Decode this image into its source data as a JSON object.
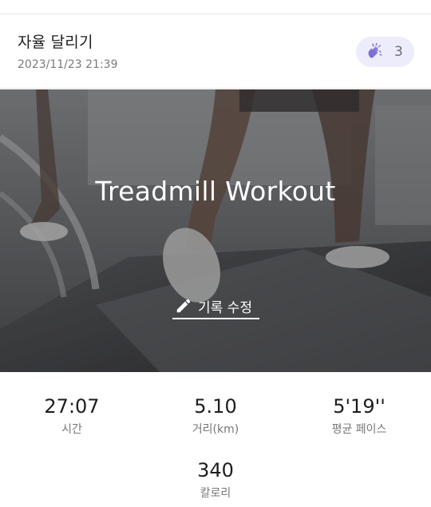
{
  "record": {
    "title": "자율 달리기",
    "datetime": "2023/11/23 21:39",
    "clap_icon": "clapping-hands-icon",
    "clap_count": "3"
  },
  "hero": {
    "title": "Treadmill Workout",
    "edit_icon": "pencil-icon",
    "edit_label": "기록 수정"
  },
  "stats": [
    {
      "value": "27:07",
      "label": "시간"
    },
    {
      "value": "5.10",
      "label": "거리(km)"
    },
    {
      "value": "5'19''",
      "label": "평균 페이스"
    },
    {
      "value": "340",
      "label": "칼로리"
    }
  ],
  "colors": {
    "clap_badge_bg": "#ececfb",
    "clap_icon": "#7c6fd6"
  }
}
